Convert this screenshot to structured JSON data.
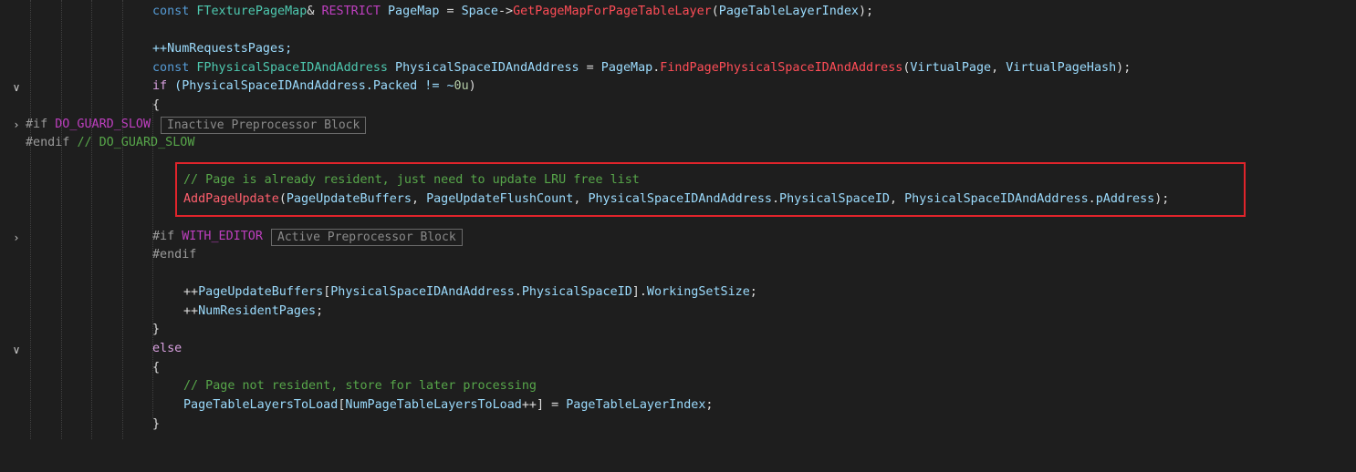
{
  "lines": {
    "l1": {
      "kw": "const",
      "type": "FTexturePageMap",
      "amp": "& ",
      "restrict": "RESTRICT",
      "var": " PageMap",
      "eq": " = ",
      "space": "Space",
      "arrow": "->",
      "fn": "GetPageMapForPageTableLayer",
      "open": "(",
      "arg": "PageTableLayerIndex",
      "close": ");"
    },
    "l2": {
      "text": "++NumRequestsPages;"
    },
    "l3": {
      "kw": "const",
      "type": "FPhysicalSpaceIDAndAddress",
      "var": " PhysicalSpaceIDAndAddress",
      "eq": " = ",
      "obj": "PageMap",
      "dot": ".",
      "fn": "FindPagePhysicalSpaceIDAndAddress",
      "open": "(",
      "arg1": "VirtualPage",
      "sep": ", ",
      "arg2": "VirtualPageHash",
      "close": ");"
    },
    "l4": {
      "kw": "if",
      "text": " (PhysicalSpaceIDAndAddress.Packed != ~",
      "num": "0u",
      "close": ")"
    },
    "l5": {
      "text": "{"
    },
    "l6": {
      "directive": "#if",
      "macro": "DO_GUARD_SLOW",
      "tag": "Inactive Preprocessor Block"
    },
    "l7": {
      "directive": "#endif",
      "comment": "// DO_GUARD_SLOW"
    },
    "l8": {
      "comment": "// Page is already resident, just need to update LRU free list"
    },
    "l9": {
      "fn": "AddPageUpdate",
      "open": "(",
      "a1": "PageUpdateBuffers",
      "s1": ", ",
      "a2": "PageUpdateFlushCount",
      "s2": ", ",
      "a3": "PhysicalSpaceIDAndAddress",
      "d3": ".",
      "m3": "PhysicalSpaceID",
      "s3": ", ",
      "a4": "PhysicalSpaceIDAndAddress",
      "d4": ".",
      "m4": "pAddress",
      "close": ");"
    },
    "l10": {
      "directive": "#if",
      "macro": "WITH_EDITOR",
      "tag": "Active Preprocessor Block"
    },
    "l11": {
      "directive": "#endif"
    },
    "l12": {
      "pre": "++",
      "a": "PageUpdateBuffers",
      "ob": "[",
      "b": "PhysicalSpaceIDAndAddress",
      "dot": ".",
      "c": "PhysicalSpaceID",
      "cb": "]",
      "dot2": ".",
      "d": "WorkingSetSize",
      "end": ";"
    },
    "l13": {
      "pre": "++",
      "a": "NumResidentPages",
      "end": ";"
    },
    "l14": {
      "text": "}"
    },
    "l15": {
      "kw": "else"
    },
    "l16": {
      "text": "{"
    },
    "l17": {
      "comment": "// Page not resident, store for later processing"
    },
    "l18": {
      "a": "PageTableLayersToLoad",
      "ob": "[",
      "b": "NumPageTableLayersToLoad",
      "inc": "++",
      "cb": "]",
      "eq": " = ",
      "c": "PageTableLayerIndex",
      "end": ";"
    },
    "l19": {
      "text": "}"
    }
  },
  "folds": {
    "expanded": "∨",
    "collapsed": "›"
  },
  "colors": {
    "background": "#1e1e1e",
    "highlight_border": "#e0242b",
    "comment": "#57a64a",
    "keyword": "#569cd6",
    "type": "#4ec9b0"
  }
}
